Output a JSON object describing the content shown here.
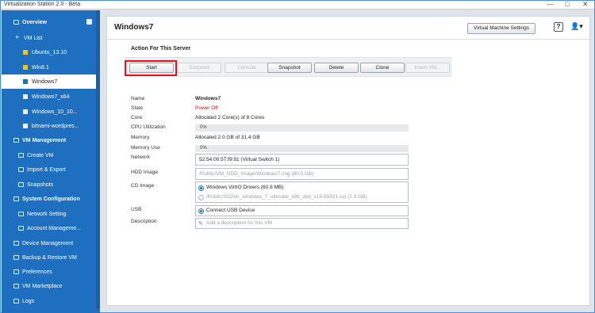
{
  "window": {
    "title": "Virtualization Station 2.0 - Beta",
    "controls": {
      "minimize": "—",
      "maximize": "□",
      "close": "✕"
    }
  },
  "sidebar": {
    "items": [
      {
        "label": "Overview",
        "bold": true,
        "icon": "overview-icon"
      },
      {
        "label": "VM List",
        "icon": "expand-icon"
      },
      {
        "label": "Ubuntu_13.10",
        "icon": "vm-yellow-icon"
      },
      {
        "label": "Win8.1",
        "icon": "vm-yellow-icon"
      },
      {
        "label": "Windows7",
        "icon": "vm-white-icon",
        "selected": true
      },
      {
        "label": "Windows7_x64",
        "icon": "vm-white-icon"
      },
      {
        "label": "Windows_10_10...",
        "icon": "vm-white-icon"
      },
      {
        "label": "bitnami-wordpres...",
        "icon": "vm-white-icon"
      },
      {
        "label": "VM Management",
        "bold": true,
        "icon": "vm-management-icon"
      },
      {
        "label": "Create VM",
        "icon": "create-vm-icon"
      },
      {
        "label": "Import & Export",
        "icon": "import-export-icon"
      },
      {
        "label": "Snapshots",
        "icon": "snapshot-icon"
      },
      {
        "label": "System Configuration",
        "bold": true,
        "icon": "system-config-icon"
      },
      {
        "label": "Network Setting",
        "icon": "network-icon"
      },
      {
        "label": "Account Manageme...",
        "icon": "account-icon"
      },
      {
        "label": "Device Management",
        "icon": "device-icon"
      },
      {
        "label": "Backup & Restore VM",
        "icon": "backup-icon"
      },
      {
        "label": "Preferences",
        "icon": "preferences-icon"
      },
      {
        "label": "VM Marketplace",
        "icon": "marketplace-icon"
      },
      {
        "label": "Logs",
        "icon": "logs-icon"
      }
    ]
  },
  "header": {
    "title": "Windows7",
    "vm_settings_label": "Virtual Machine Settings",
    "help_label": "?",
    "user_icon": "user-icon"
  },
  "actions": {
    "section_title": "Action For This Server",
    "buttons": [
      {
        "label": "Start",
        "enabled": true
      },
      {
        "label": "Suspend",
        "enabled": false
      },
      {
        "label": "Console",
        "enabled": false
      },
      {
        "label": "Snapshot",
        "enabled": true
      },
      {
        "label": "Delete",
        "enabled": true
      },
      {
        "label": "Clone",
        "enabled": true
      },
      {
        "label": "Insert VM...",
        "enabled": false
      }
    ]
  },
  "properties": {
    "name": {
      "label": "Name",
      "value": "Windows7"
    },
    "state": {
      "label": "State",
      "value": "Power Off"
    },
    "core": {
      "label": "Core",
      "value": "Allocated 2 Core(s) of 8 Cores"
    },
    "cpu": {
      "label": "CPU Utilization",
      "value": "0%",
      "percent": 0
    },
    "memory": {
      "label": "Memory",
      "value": "Allocated 2.0 GB of 31.4 GB"
    },
    "memory_use": {
      "label": "Memory Use",
      "value": "0%",
      "percent": 0
    },
    "network": {
      "label": "Network",
      "value": "52:54:00:57:f9:91 (Virtual Switch 1)"
    },
    "hdd": {
      "label": "HDD Image",
      "value": "/Public/VM_HDD_Image/Windows7.img (80.0 GB)"
    },
    "cd": {
      "label": "CD Image",
      "options": [
        {
          "value": "Windows VirtIO Drivers (60.8 MB)",
          "selected": true
        },
        {
          "value": "/Public/ISO/en_windows_7_ultimate_x86_dvd_x15-65921.iso (2.3 GB)",
          "selected": false
        }
      ]
    },
    "usb": {
      "label": "USB",
      "value": "Connect USB Device"
    },
    "description": {
      "label": "Description",
      "placeholder": "Add a description for this VM"
    }
  },
  "colors": {
    "sidebar": "#1f6fc1",
    "accent_red": "#e8101a",
    "selected_bg": "#ffffff"
  }
}
